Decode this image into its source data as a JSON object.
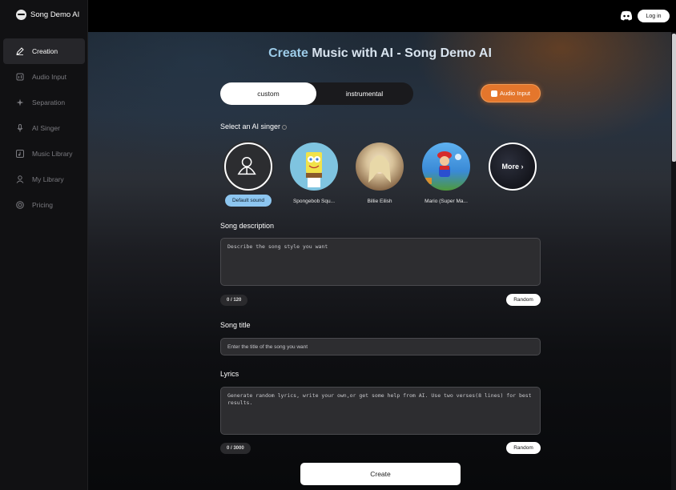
{
  "app": {
    "name": "Song Demo AI"
  },
  "sidebar": {
    "items": [
      {
        "label": "Creation",
        "icon": "pencil-icon"
      },
      {
        "label": "Audio Input",
        "icon": "audio-file-icon"
      },
      {
        "label": "Separation",
        "icon": "separation-icon"
      },
      {
        "label": "AI Singer",
        "icon": "microphone-icon"
      },
      {
        "label": "Music Library",
        "icon": "music-library-icon"
      },
      {
        "label": "My Library",
        "icon": "user-icon"
      },
      {
        "label": "Pricing",
        "icon": "pricing-icon"
      }
    ]
  },
  "topbar": {
    "login_label": "Log in",
    "discord_icon": "discord-icon"
  },
  "main": {
    "title_accent": "Create",
    "title_rest": " Music with AI - Song Demo AI",
    "modes": {
      "custom": "custom",
      "instrumental": "instrumental"
    },
    "audio_input_label": "Audio Input",
    "select_singer_label": "Select an AI singer",
    "singers": [
      {
        "label": "Default sound"
      },
      {
        "label": "Spongebob Squ..."
      },
      {
        "label": "Billie Eilish"
      },
      {
        "label": "Mario (Super Ma..."
      },
      {
        "label": "More"
      }
    ],
    "song_description": {
      "label": "Song description",
      "placeholder": "Describe the song style you want",
      "counter": "0 / 120",
      "random_label": "Random"
    },
    "song_title": {
      "label": "Song title",
      "placeholder": "Enter the title of the song you want"
    },
    "lyrics": {
      "label": "Lyrics",
      "placeholder": "Generate random lyrics, write your own,or get some help from AI. Use two verses(8 lines) for best results.",
      "counter": "0 / 3000",
      "random_label": "Random"
    },
    "create_label": "Create"
  },
  "colors": {
    "accent_blue": "#9ccbe8",
    "audio_orange": "#e4762c",
    "selected_chip": "#8dc6f0"
  }
}
